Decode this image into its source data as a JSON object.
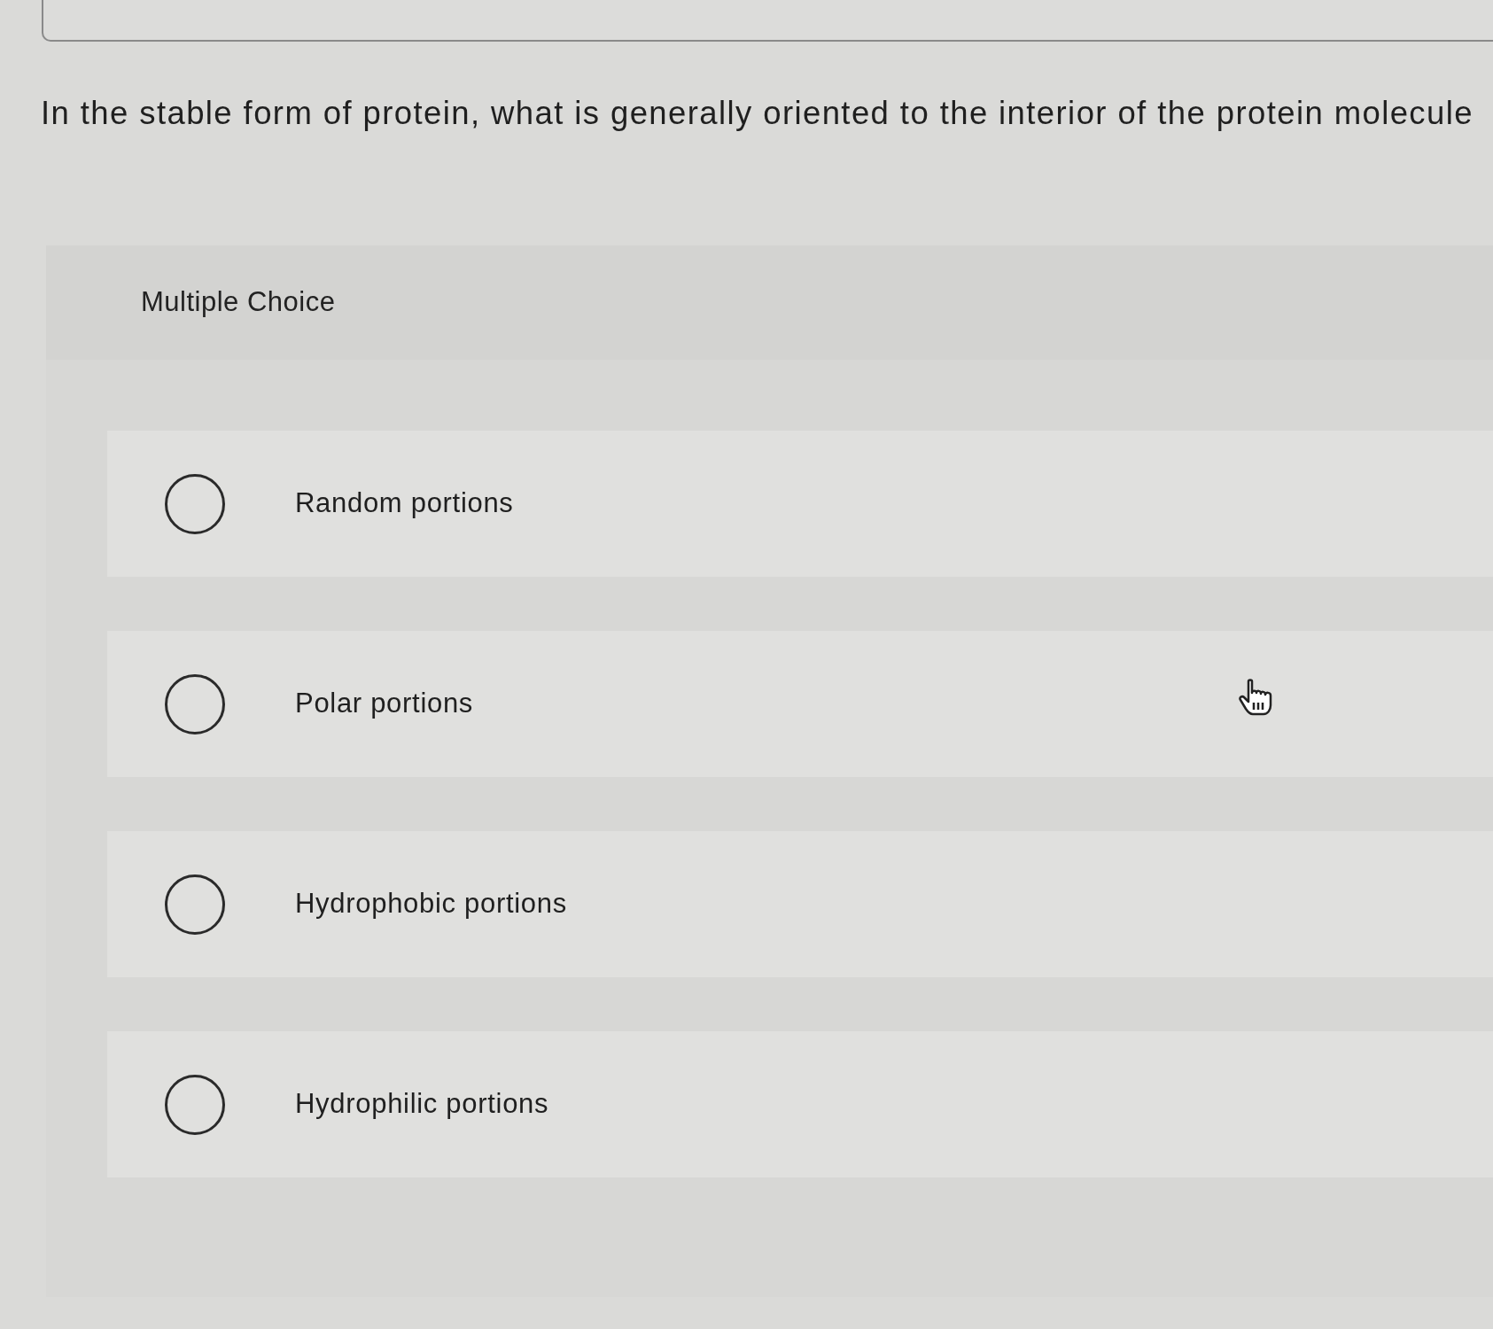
{
  "question": {
    "text": "In the stable form of protein, what is generally oriented to the interior of the protein molecule"
  },
  "answer_panel": {
    "heading": "Multiple Choice",
    "options": [
      {
        "label": "Random portions",
        "selected": false
      },
      {
        "label": "Polar portions",
        "selected": false
      },
      {
        "label": "Hydrophobic portions",
        "selected": false
      },
      {
        "label": "Hydrophilic portions",
        "selected": false
      }
    ]
  },
  "pointer": {
    "kind": "hand"
  }
}
